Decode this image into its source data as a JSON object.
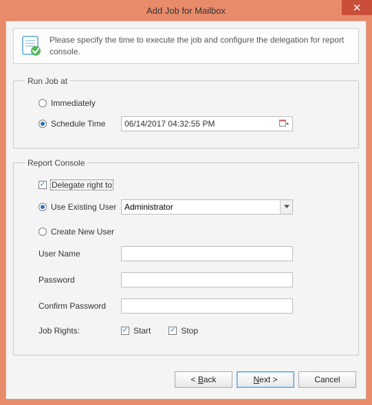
{
  "window": {
    "title": "Add Job for Mailbox"
  },
  "instruction": {
    "text": "Please specify the time to execute the job and configure the delegation for report console."
  },
  "runJob": {
    "legend": "Run Job at",
    "immediately": {
      "label": "Immediately",
      "checked": false
    },
    "scheduleTime": {
      "label": "Schedule Time",
      "checked": true,
      "value": "06/14/2017 04:32:55 PM"
    }
  },
  "reportConsole": {
    "legend": "Report Console",
    "delegate": {
      "label": "Delegate right to",
      "checked": true
    },
    "useExisting": {
      "label": "Use Existing User",
      "checked": true,
      "value": "Administrator"
    },
    "createNew": {
      "label": "Create New User",
      "checked": false
    },
    "userName": {
      "label": "User Name",
      "value": ""
    },
    "password": {
      "label": "Password",
      "value": ""
    },
    "confirmPassword": {
      "label": "Confirm Password",
      "value": ""
    },
    "jobRights": {
      "label": "Job Rights:",
      "start": {
        "label": "Start",
        "checked": true
      },
      "stop": {
        "label": "Stop",
        "checked": true
      }
    }
  },
  "buttons": {
    "back": "< Back",
    "next": "Next >",
    "cancel": "Cancel"
  }
}
